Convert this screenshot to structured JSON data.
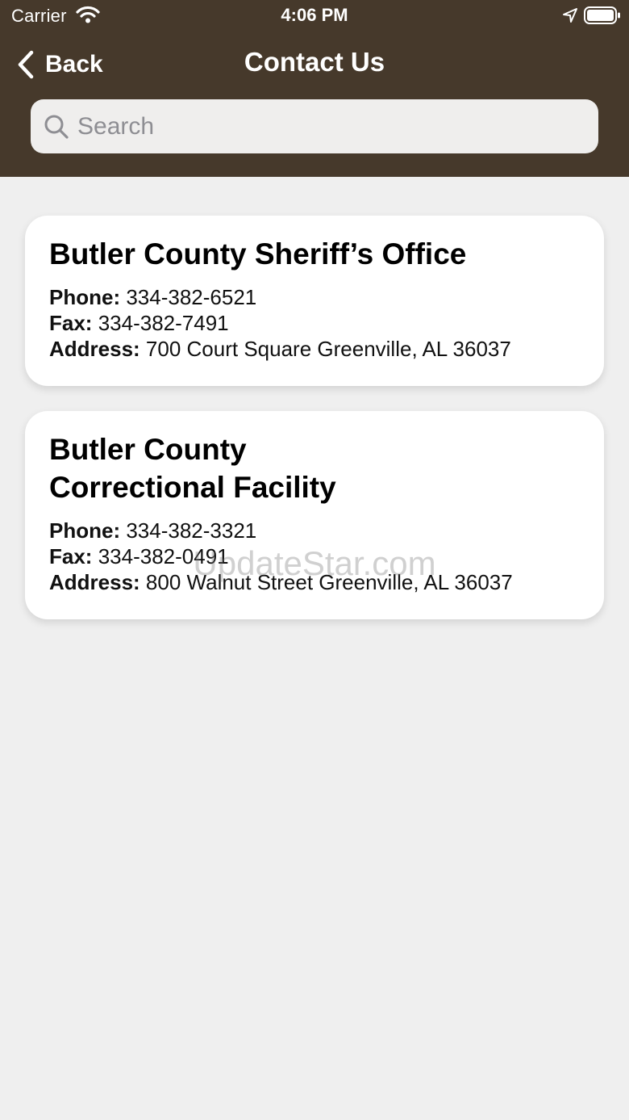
{
  "status_bar": {
    "carrier": "Carrier",
    "time": "4:06 PM"
  },
  "nav": {
    "back_label": "Back",
    "title": "Contact Us"
  },
  "search": {
    "placeholder": "Search",
    "value": ""
  },
  "contacts": [
    {
      "name": "Butler County Sheriff’s Office",
      "phone_label": "Phone:",
      "phone": " 334-382-6521",
      "fax_label": "Fax:",
      "fax": " 334-382-7491",
      "address_label": "Address:",
      "address": " 700 Court Square Greenville, AL 36037"
    },
    {
      "name": "Butler County\nCorrectional Facility",
      "phone_label": "Phone:",
      "phone": " 334-382-3321",
      "fax_label": "Fax:",
      "fax": " 334-382-0491",
      "address_label": "Address:",
      "address": " 800 Walnut Street Greenville, AL 36037"
    }
  ],
  "watermark": "UpdateStar.com",
  "colors": {
    "header": "#46392b",
    "background": "#efefef",
    "card": "#ffffff"
  },
  "icons": [
    "wifi-icon",
    "location-icon",
    "battery-icon",
    "chevron-left-icon",
    "search-icon"
  ]
}
